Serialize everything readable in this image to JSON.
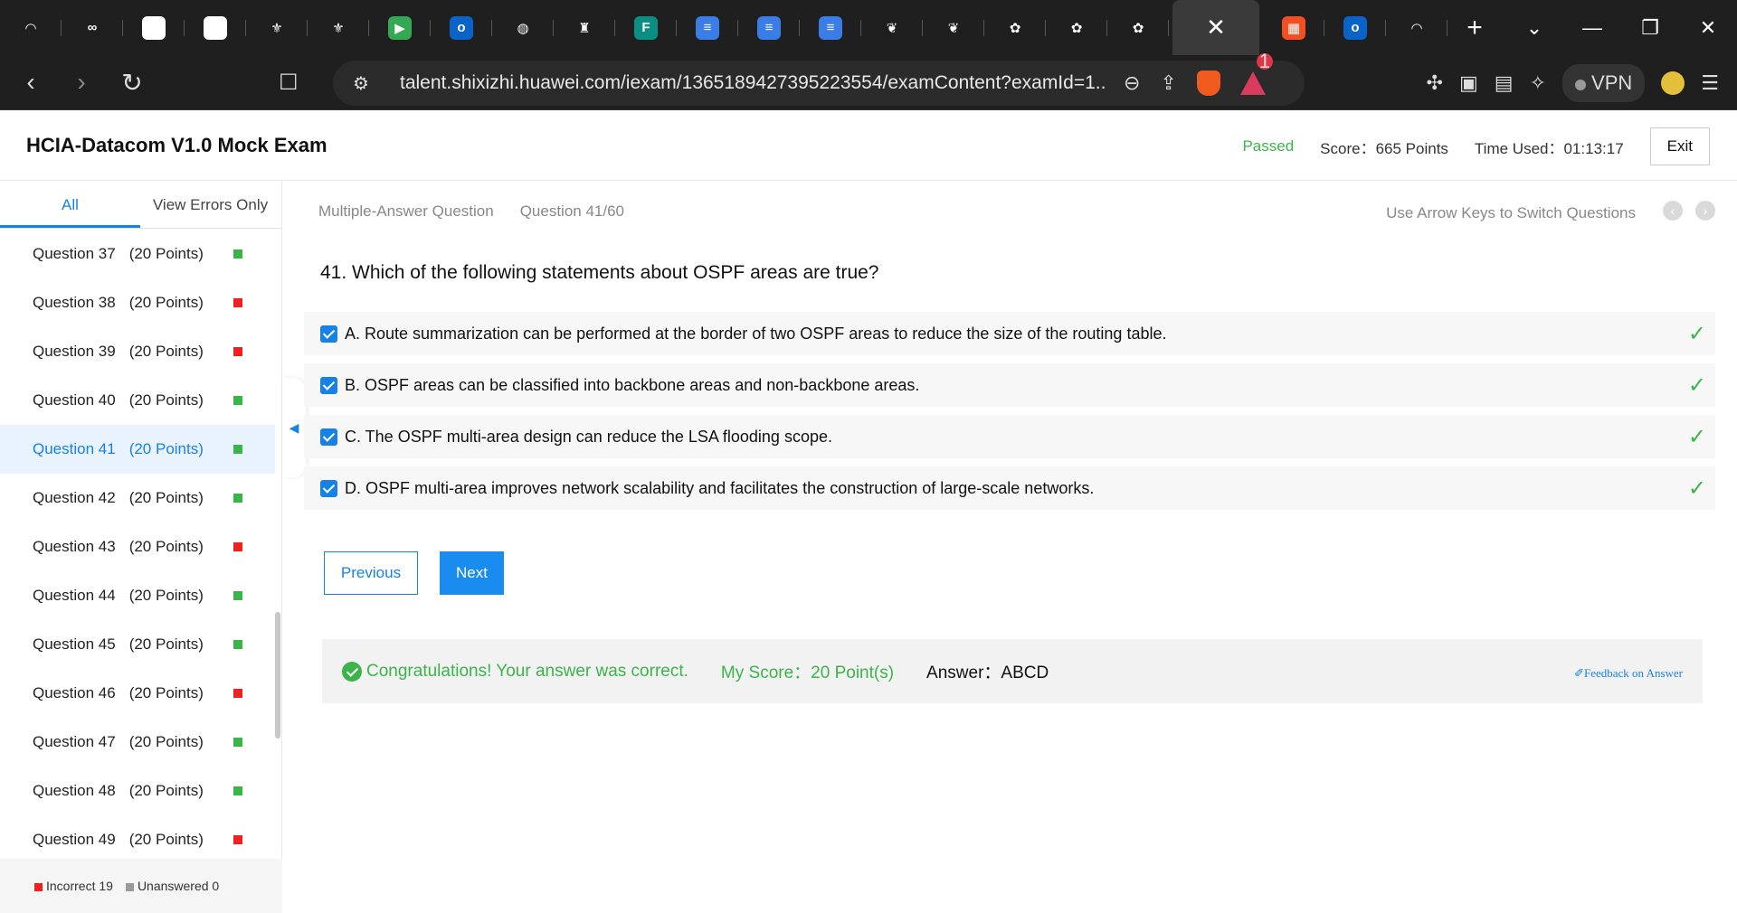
{
  "browser": {
    "tabs": [
      {
        "icon": "speedometer-icon",
        "color": "#1f1f1f",
        "glyph": "◠"
      },
      {
        "icon": "infinity-icon",
        "color": "#1f1f1f",
        "glyph": "∞"
      },
      {
        "icon": "six-logo-icon",
        "color": "#ffffff",
        "glyph": "6"
      },
      {
        "icon": "six-logo-icon",
        "color": "#ffffff",
        "glyph": "6"
      },
      {
        "icon": "crest-icon",
        "color": "#1f1f1f",
        "glyph": "⚜"
      },
      {
        "icon": "crest-icon",
        "color": "#1f1f1f",
        "glyph": "⚜"
      },
      {
        "icon": "meet-icon",
        "color": "#34a853",
        "glyph": "▶"
      },
      {
        "icon": "outlook-icon",
        "color": "#0a64c8",
        "glyph": "o"
      },
      {
        "icon": "globe-icon",
        "color": "#1f1f1f",
        "glyph": "◍"
      },
      {
        "icon": "castle-icon",
        "color": "#1f1f1f",
        "glyph": "♜"
      },
      {
        "icon": "forms-icon",
        "color": "#0b8f84",
        "glyph": "F"
      },
      {
        "icon": "docs-icon",
        "color": "#3b7de6",
        "glyph": "≡"
      },
      {
        "icon": "docs-icon",
        "color": "#3b7de6",
        "glyph": "≡"
      },
      {
        "icon": "docs-icon",
        "color": "#3b7de6",
        "glyph": "≡"
      },
      {
        "icon": "whale-icon",
        "color": "#1f1f1f",
        "glyph": "❦"
      },
      {
        "icon": "whale-icon",
        "color": "#1f1f1f",
        "glyph": "❦"
      },
      {
        "icon": "huawei-icon",
        "color": "#1f1f1f",
        "glyph": "✿"
      },
      {
        "icon": "huawei-icon",
        "color": "#1f1f1f",
        "glyph": "✿"
      },
      {
        "icon": "huawei-icon",
        "color": "#1f1f1f",
        "glyph": "✿"
      }
    ],
    "active_tab_close": "✕",
    "tabs_after": [
      {
        "icon": "microsoft-icon",
        "color": "#f25022",
        "glyph": "▦"
      },
      {
        "icon": "outlook-icon",
        "color": "#0a64c8",
        "glyph": "o"
      },
      {
        "icon": "speedometer-icon",
        "color": "#1f1f1f",
        "glyph": "◠"
      }
    ],
    "new_tab": "+",
    "url": "talent.shixizhi.huawei.com/iexam/1365189427395223554/examContent?examId=1...",
    "rewards_count": "1",
    "vpn_label": "VPN"
  },
  "header": {
    "title": "HCIA-Datacom V1.0 Mock Exam",
    "status": "Passed",
    "score": "Score：665 Points",
    "time_used": "Time Used：01:13:17",
    "exit_label": "Exit"
  },
  "sidebar": {
    "tabs": [
      "All",
      "View Errors Only"
    ],
    "questions": [
      {
        "label": "Question 37",
        "points": "(20 Points)",
        "status": "green"
      },
      {
        "label": "Question 38",
        "points": "(20 Points)",
        "status": "red"
      },
      {
        "label": "Question 39",
        "points": "(20 Points)",
        "status": "red"
      },
      {
        "label": "Question 40",
        "points": "(20 Points)",
        "status": "green"
      },
      {
        "label": "Question 41",
        "points": "(20 Points)",
        "status": "green",
        "current": true
      },
      {
        "label": "Question 42",
        "points": "(20 Points)",
        "status": "green"
      },
      {
        "label": "Question 43",
        "points": "(20 Points)",
        "status": "red"
      },
      {
        "label": "Question 44",
        "points": "(20 Points)",
        "status": "green"
      },
      {
        "label": "Question 45",
        "points": "(20 Points)",
        "status": "green"
      },
      {
        "label": "Question 46",
        "points": "(20 Points)",
        "status": "red"
      },
      {
        "label": "Question 47",
        "points": "(20 Points)",
        "status": "green"
      },
      {
        "label": "Question 48",
        "points": "(20 Points)",
        "status": "green"
      },
      {
        "label": "Question 49",
        "points": "(20 Points)",
        "status": "red"
      }
    ],
    "legend_incorrect": "Incorrect 19",
    "legend_unanswered": "Unanswered 0",
    "colors": {
      "correct": "#3bb54a",
      "incorrect": "#f02020",
      "unanswered": "#999999"
    }
  },
  "question": {
    "type": "Multiple-Answer Question",
    "number": "Question 41/60",
    "hint": "Use Arrow Keys to Switch Questions",
    "text": "41. Which of the following statements about OSPF areas are true?",
    "options": [
      "A. Route summarization can be performed at the border of two OSPF areas to reduce the size of the routing table.",
      "B. OSPF areas can be classified into backbone areas and non-backbone areas.",
      "C. The OSPF multi-area design can reduce the LSA flooding scope.",
      "D. OSPF multi-area improves network scalability and facilitates the construction of large-scale networks."
    ],
    "previous_label": "Previous",
    "next_label": "Next"
  },
  "result": {
    "message": "Congratulations! Your answer was correct.",
    "my_score": "My Score：20 Point(s)",
    "answer": "Answer：ABCD",
    "feedback": "✐Feedback on Answer"
  }
}
